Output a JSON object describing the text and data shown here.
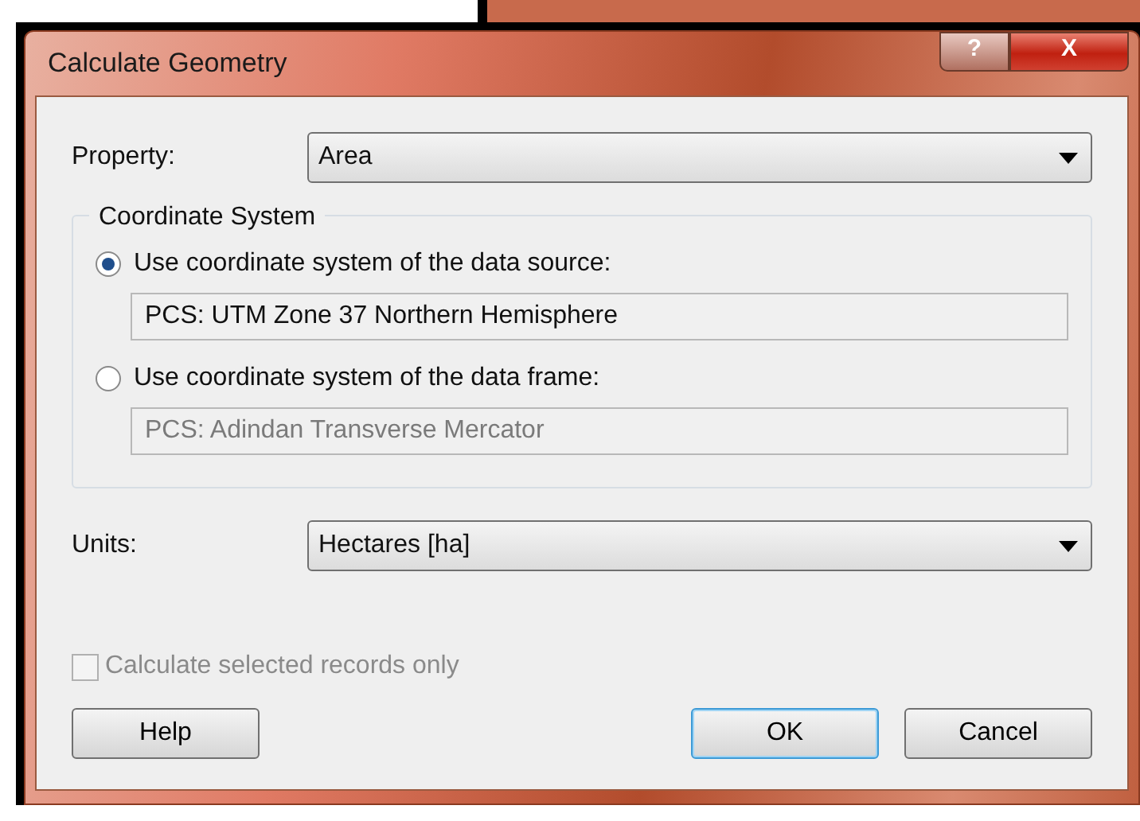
{
  "window": {
    "title": "Calculate Geometry",
    "title_buttons": [
      {
        "kind": "help",
        "label": "?"
      },
      {
        "kind": "close",
        "label": "X"
      }
    ]
  },
  "property": {
    "label": "Property:",
    "value": "Area"
  },
  "coordinate_system": {
    "title": "Coordinate System",
    "options": [
      {
        "label": "Use coordinate system of the data source:",
        "selected": true,
        "value": "PCS: UTM Zone 37 Northern Hemisphere"
      },
      {
        "label": "Use coordinate system of the data frame:",
        "selected": false,
        "value": "PCS: Adindan Transverse Mercator"
      }
    ]
  },
  "units": {
    "label": "Units:",
    "value": "Hectares [ha]"
  },
  "selected_only": {
    "label": "Calculate selected records only",
    "checked": false,
    "disabled": true
  },
  "buttons": [
    {
      "label": "Help",
      "kind": "left",
      "default": false
    },
    {
      "label": "OK",
      "kind": "right",
      "default": true
    },
    {
      "label": "Cancel",
      "kind": "right",
      "default": false
    }
  ]
}
